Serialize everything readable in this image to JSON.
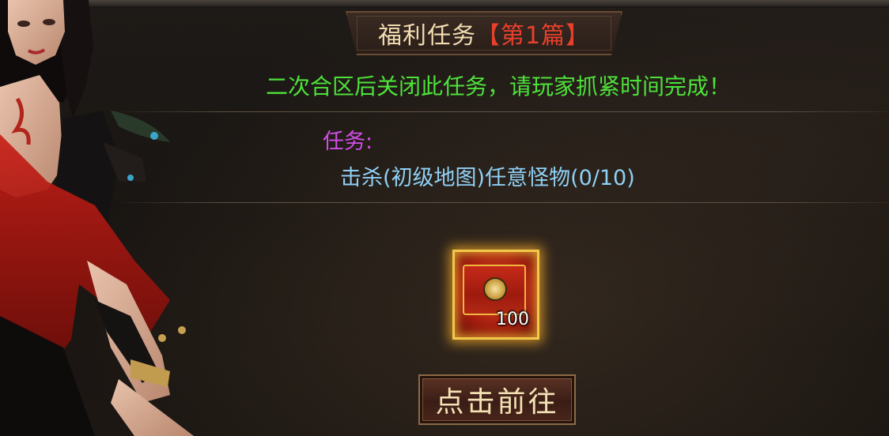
{
  "header": {
    "title": "福利任务",
    "chapter": "【第1篇】"
  },
  "notice": "二次合区后关闭此任务，请玩家抓紧时间完成！",
  "task": {
    "label": "任务:",
    "description": "击杀(初级地图)任意怪物(0/10)"
  },
  "reward": {
    "icon": "red-treasure-chest-icon",
    "quantity": "100"
  },
  "action_button": {
    "label": "点击前往"
  },
  "colors": {
    "title": "#f2ddb2",
    "chapter": "#e8402d",
    "notice": "#4de23a",
    "task_label": "#d14ee6",
    "task_desc": "#8fd0f5",
    "reward_border": "#f2c84a",
    "button_text": "#f4e2b5"
  }
}
